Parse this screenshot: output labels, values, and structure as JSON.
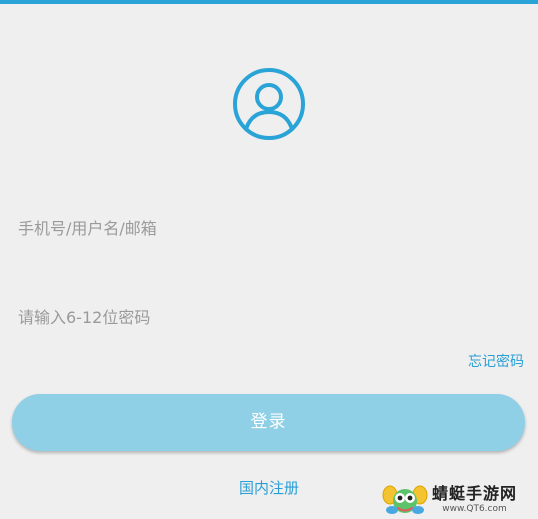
{
  "form": {
    "username_placeholder": "手机号/用户名/邮箱",
    "password_placeholder": "请输入6-12位密码",
    "forgot_password": "忘记密码",
    "login_button": "登录",
    "register_link": "国内注册"
  },
  "watermark": {
    "title": "蜻蜓手游网",
    "url": "www.QT6.com"
  },
  "icons": {
    "avatar": "user-avatar-icon",
    "watermark_logo": "dragonfly-logo-icon"
  },
  "colors": {
    "accent": "#2aa3d6",
    "button": "#8fd0e6",
    "background": "#efefef"
  }
}
